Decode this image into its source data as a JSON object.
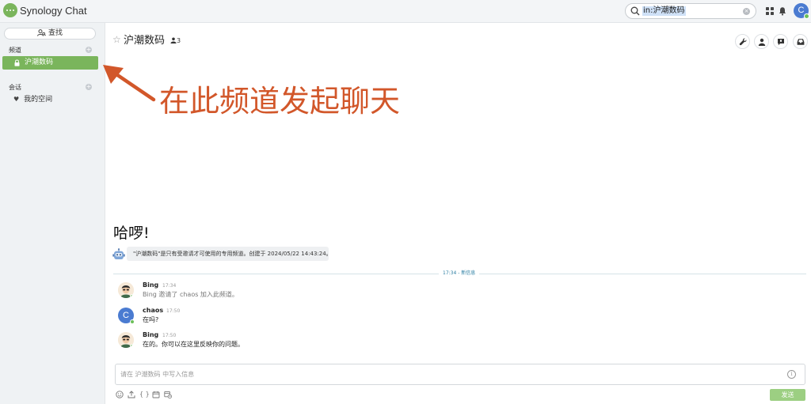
{
  "app": {
    "title": "Synology Chat"
  },
  "search": {
    "value": "in:沪潮数码"
  },
  "user": {
    "initial": "C"
  },
  "sidebar": {
    "find_label": "查找",
    "channels_title": "频道",
    "channels": [
      {
        "label": "沪潮数码",
        "selected": true
      }
    ],
    "conversations_title": "会话",
    "conversations": [
      {
        "label": "我的空间"
      }
    ]
  },
  "channel": {
    "name": "沪潮数码",
    "member_count": "3",
    "greeting": "哈啰!",
    "intro": "\"沪潮数码\"是只有受邀请才可使用的专用频道。创建于 2024/05/22 14:43:24。"
  },
  "divider": {
    "label": "17:34 - 新信息"
  },
  "messages": [
    {
      "author": "Bing",
      "time": "17:34",
      "text": "Bing 邀请了 chaos 加入此频道。",
      "system": true
    },
    {
      "author": "chaos",
      "time": "17:50",
      "text": "在吗?",
      "avatar_initial": "C"
    },
    {
      "author": "Bing",
      "time": "17:50",
      "text": "在的。你可以在这里反映你的问题。"
    }
  ],
  "composer": {
    "placeholder": "请在 沪潮数码 中写入信息",
    "code_icon": "{ }",
    "send_label": "发送"
  },
  "annotation": {
    "text": "在此频道发起聊天"
  },
  "colors": {
    "accent_green": "#7ab55c",
    "annotation_orange": "#d2572a",
    "avatar_blue": "#4a7bd1"
  }
}
